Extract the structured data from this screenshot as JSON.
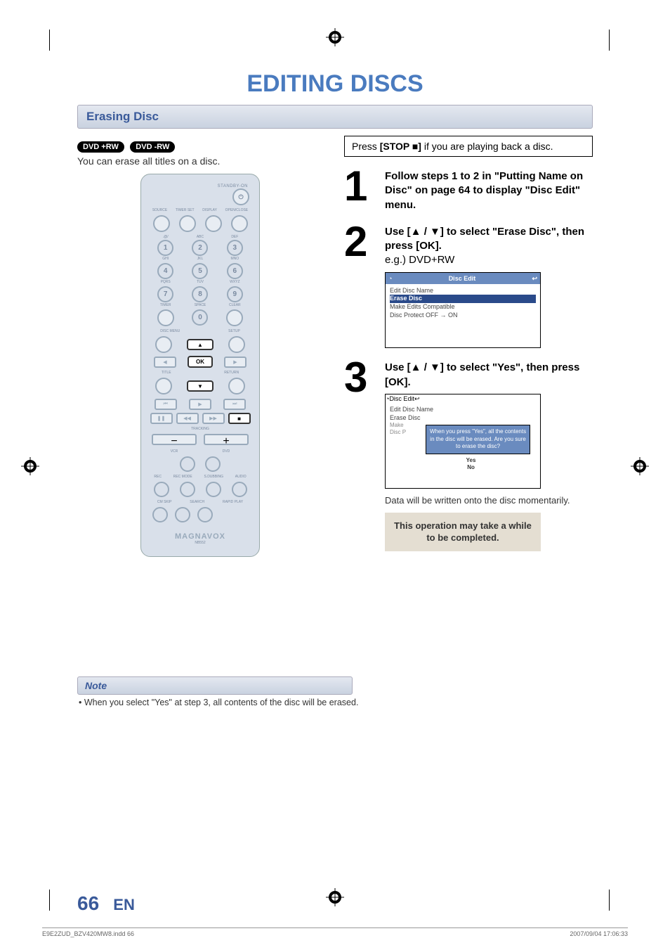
{
  "title": "EDITING DISCS",
  "section_title": "Erasing Disc",
  "badges": [
    "DVD +RW",
    "DVD -RW"
  ],
  "intro": "You can erase all titles on a disc.",
  "pressbox_parts": [
    "Press ",
    "[STOP ■]",
    " if you are playing back a disc."
  ],
  "steps": {
    "s1": {
      "num": "1",
      "txt": "Follow steps 1 to 2 in \"Putting Name on Disc\" on page 64 to display \"Disc Edit\" menu."
    },
    "s2": {
      "num": "2",
      "bold": "Use [▲ / ▼] to select \"Erase Disc\", then press [OK].",
      "sub": "e.g.) DVD+RW"
    },
    "s3": {
      "num": "3",
      "bold": "Use [▲ / ▼] to select \"Yes\", then press [OK]."
    }
  },
  "menu1": {
    "title": "Disc Edit",
    "items": [
      "Edit Disc Name",
      "Erase Disc",
      "Make Edits Compatible",
      "Disc Protect OFF → ON"
    ]
  },
  "dialog": {
    "title": "Disc Edit",
    "bg_items": [
      "Edit Disc Name",
      "Erase Disc",
      "Make",
      "Disc P"
    ],
    "msg": "When you press \"Yes\", all the contents in the disc will be erased. Are you sure to erase the disc?",
    "yes": "Yes",
    "no": "No"
  },
  "datanote": "Data will be written onto the disc momentarily.",
  "graybox": "This operation may take a while to be completed.",
  "note_title": "Note",
  "note_text": "• When you select \"Yes\" at step 3, all contents of the disc will be erased.",
  "page_num": "66",
  "page_lang": "EN",
  "printfile": "E9E2ZUD_BZV420MW8.indd   66",
  "printdate": "2007/09/04   17:06:33",
  "remote": {
    "standby": "STANDBY-ON",
    "row1": [
      "SOURCE",
      "TIMER SET",
      "DISPLAY",
      "OPEN/CLOSE"
    ],
    "row2sub": [
      ".@/",
      "ABC",
      "DEF"
    ],
    "nums": [
      "1",
      "2",
      "3",
      "4",
      "5",
      "6",
      "7",
      "8",
      "9",
      "0"
    ],
    "numsub": [
      "GHI",
      "JKL",
      "MNO",
      "PQRS",
      "TUV",
      "WXYZ",
      "TIMER",
      "SPACE",
      "CLEAR"
    ],
    "discmenu": "DISC MENU",
    "setup": "SETUP",
    "title_l": "TITLE",
    "return": "RETURN",
    "ok": "OK",
    "tracking": "TRACKING",
    "vcr": "VCR",
    "dvd": "DVD",
    "rec": "REC",
    "recmode": "REC MODE",
    "sdub": "S.DUBBING",
    "audio": "AUDIO",
    "cmskip": "CM SKIP",
    "search": "SEARCH",
    "rapid": "RAPID PLAY",
    "brand": "MAGNAVOX",
    "model": "NB552"
  }
}
